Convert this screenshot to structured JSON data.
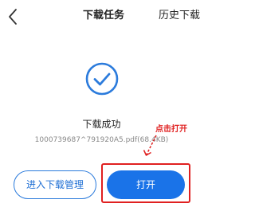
{
  "header": {
    "back_icon": "chevron-left-icon",
    "tab_download_tasks": "下载任务",
    "tab_history": "历史下载"
  },
  "status": {
    "icon": "check-circle-icon",
    "title": "下载成功",
    "file_name": "1000739687^791920A5.pdf(68.4KB)"
  },
  "actions": {
    "manage_label": "进入下载管理",
    "open_label": "打开"
  },
  "annotation": {
    "text": "点击打开",
    "color": "#e02020"
  },
  "colors": {
    "accent": "#1a73e8",
    "icon_blue": "#2b7bdc",
    "annotation_red": "#e02020"
  }
}
